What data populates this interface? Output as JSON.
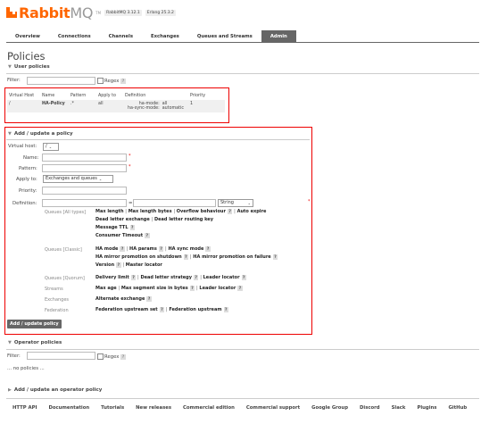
{
  "header": {
    "logo_rabbit": "Rabbit",
    "logo_mq": "MQ",
    "logo_tm": "TM",
    "rabbitmq_version": "RabbitMQ 3.12.1",
    "erlang_version": "Erlang 25.3.2"
  },
  "tabs": [
    "Overview",
    "Connections",
    "Channels",
    "Exchanges",
    "Queues and Streams",
    "Admin"
  ],
  "page_title": "Policies",
  "user_policies": {
    "title": "User policies",
    "filter_label": "Filter:",
    "regex_label": "Regex",
    "help": "?",
    "columns": [
      "Virtual Host",
      "Name",
      "Pattern",
      "Apply to",
      "Definition",
      "Priority"
    ],
    "row": {
      "vhost": "/",
      "name": "HA-Policy",
      "pattern": ".*",
      "apply_to": "all",
      "def_key1": "ha-mode:",
      "def_val1": "all",
      "def_key2": "ha-sync-mode:",
      "def_val2": "automatic",
      "priority": "1"
    }
  },
  "add_policy": {
    "title": "Add / update a policy",
    "virtual_host_label": "Virtual host:",
    "virtual_host_value": "/",
    "name_label": "Name:",
    "pattern_label": "Pattern:",
    "apply_to_label": "Apply to:",
    "apply_to_value": "Exchanges and queues",
    "priority_label": "Priority:",
    "definition_label": "Definition:",
    "eq": "=",
    "type_value": "String",
    "required": "*",
    "categories": {
      "all_types": "Queues [All types]",
      "classic": "Queues [Classic]",
      "quorum": "Queues [Quorum]",
      "streams": "Streams",
      "exchanges": "Exchanges",
      "federation": "Federation"
    },
    "keys": {
      "all_1": "Max length",
      "all_2": "Max length bytes",
      "all_3": "Overflow behaviour",
      "all_4": "Auto expire",
      "all_5": "Dead letter exchange",
      "all_6": "Dead letter routing key",
      "all_7": "Message TTL",
      "all_8": "Consumer Timeout",
      "cl_1": "HA mode",
      "cl_2": "HA params",
      "cl_3": "HA sync mode",
      "cl_4": "HA mirror promotion on shutdown",
      "cl_5": "HA mirror promotion on failure",
      "cl_6": "Version",
      "cl_7": "Master locator",
      "q_1": "Delivery limit",
      "q_2": "Dead letter strategy",
      "q_3": "Leader locator",
      "s_1": "Max age",
      "s_2": "Max segment size in bytes",
      "s_3": "Leader locator",
      "e_1": "Alternate exchange",
      "f_1": "Federation upstream set",
      "f_2": "Federation upstream"
    },
    "submit_label": "Add / update policy"
  },
  "operator_policies": {
    "title": "Operator policies",
    "filter_label": "Filter:",
    "regex_label": "Regex",
    "empty_text": "... no policies ..."
  },
  "add_operator_policy": {
    "title": "Add / update an operator policy"
  },
  "footer": [
    "HTTP API",
    "Documentation",
    "Tutorials",
    "New releases",
    "Commercial edition",
    "Commercial support",
    "Google Group",
    "Discord",
    "Slack",
    "Plugins",
    "GitHub"
  ],
  "colors": {
    "accent": "#ff6600",
    "tab_active_bg": "#666666",
    "highlight_border": "#ee0000"
  }
}
